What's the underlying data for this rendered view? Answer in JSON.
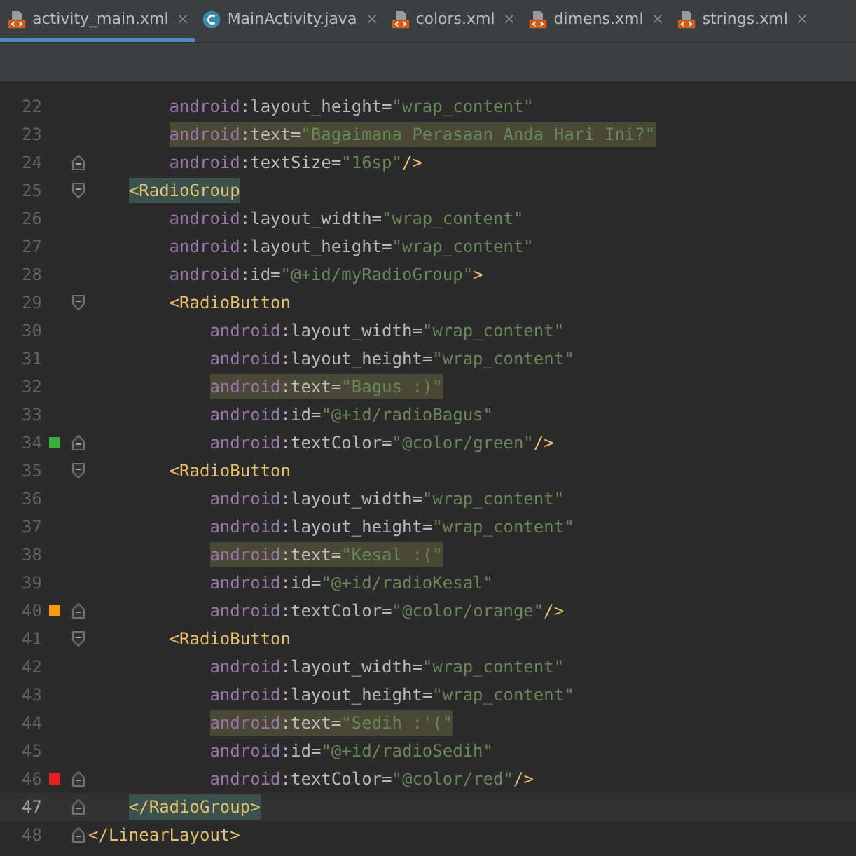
{
  "tabs": [
    {
      "label": "activity_main.xml",
      "kind": "xml",
      "selected": true
    },
    {
      "label": "MainActivity.java",
      "kind": "java",
      "selected": false
    },
    {
      "label": "colors.xml",
      "kind": "xml",
      "selected": false
    },
    {
      "label": "dimens.xml",
      "kind": "xml",
      "selected": false
    },
    {
      "label": "strings.xml",
      "kind": "xml",
      "selected": false
    }
  ],
  "lines": [
    {
      "number": "22",
      "highlighted": false,
      "tag_matched": false,
      "current": false,
      "fold_start": false,
      "fold_end": false,
      "tokens": [
        {
          "kind": "ns",
          "text": "        android"
        },
        {
          "kind": "attr",
          "text": ":layout_height="
        },
        {
          "kind": "value",
          "text": "\"wrap_content\""
        }
      ]
    },
    {
      "number": "23",
      "highlighted": true,
      "tag_matched": false,
      "current": false,
      "fold_start": false,
      "fold_end": false,
      "tokens": [
        {
          "kind": "ns",
          "text": "        android"
        },
        {
          "kind": "attr",
          "text": ":text="
        },
        {
          "kind": "value",
          "text": "\"Bagaimana Perasaan Anda Hari Ini?\""
        }
      ]
    },
    {
      "number": "24",
      "highlighted": false,
      "tag_matched": false,
      "current": false,
      "fold_start": false,
      "fold_end": true,
      "tokens": [
        {
          "kind": "ns",
          "text": "        android"
        },
        {
          "kind": "attr",
          "text": ":textSize="
        },
        {
          "kind": "value",
          "text": "\"16sp\""
        },
        {
          "kind": "tag",
          "text": "/>"
        }
      ]
    },
    {
      "number": "25",
      "highlighted": false,
      "tag_matched": true,
      "current": false,
      "fold_start": true,
      "fold_end": false,
      "tokens": [
        {
          "kind": "tag",
          "text": "    <RadioGroup"
        }
      ]
    },
    {
      "number": "26",
      "highlighted": false,
      "tag_matched": false,
      "current": false,
      "fold_start": false,
      "fold_end": false,
      "tokens": [
        {
          "kind": "ns",
          "text": "        android"
        },
        {
          "kind": "attr",
          "text": ":layout_width="
        },
        {
          "kind": "value",
          "text": "\"wrap_content\""
        }
      ]
    },
    {
      "number": "27",
      "highlighted": false,
      "tag_matched": false,
      "current": false,
      "fold_start": false,
      "fold_end": false,
      "tokens": [
        {
          "kind": "ns",
          "text": "        android"
        },
        {
          "kind": "attr",
          "text": ":layout_height="
        },
        {
          "kind": "value",
          "text": "\"wrap_content\""
        }
      ]
    },
    {
      "number": "28",
      "highlighted": false,
      "tag_matched": false,
      "current": false,
      "fold_start": false,
      "fold_end": false,
      "tokens": [
        {
          "kind": "ns",
          "text": "        android"
        },
        {
          "kind": "attr",
          "text": ":id="
        },
        {
          "kind": "value",
          "text": "\"@+id/myRadioGroup\""
        },
        {
          "kind": "tag",
          "text": ">"
        }
      ]
    },
    {
      "number": "29",
      "highlighted": false,
      "tag_matched": false,
      "current": false,
      "fold_start": true,
      "fold_end": false,
      "tokens": [
        {
          "kind": "tag",
          "text": "        <RadioButton"
        }
      ]
    },
    {
      "number": "30",
      "highlighted": false,
      "tag_matched": false,
      "current": false,
      "fold_start": false,
      "fold_end": false,
      "tokens": [
        {
          "kind": "ns",
          "text": "            android"
        },
        {
          "kind": "attr",
          "text": ":layout_width="
        },
        {
          "kind": "value",
          "text": "\"wrap_content\""
        }
      ]
    },
    {
      "number": "31",
      "highlighted": false,
      "tag_matched": false,
      "current": false,
      "fold_start": false,
      "fold_end": false,
      "tokens": [
        {
          "kind": "ns",
          "text": "            android"
        },
        {
          "kind": "attr",
          "text": ":layout_height="
        },
        {
          "kind": "value",
          "text": "\"wrap_content\""
        }
      ]
    },
    {
      "number": "32",
      "highlighted": true,
      "tag_matched": false,
      "current": false,
      "fold_start": false,
      "fold_end": false,
      "tokens": [
        {
          "kind": "ns",
          "text": "            android"
        },
        {
          "kind": "attr",
          "text": ":text="
        },
        {
          "kind": "value",
          "text": "\"Bagus :)\""
        }
      ]
    },
    {
      "number": "33",
      "highlighted": false,
      "tag_matched": false,
      "current": false,
      "fold_start": false,
      "fold_end": false,
      "tokens": [
        {
          "kind": "ns",
          "text": "            android"
        },
        {
          "kind": "attr",
          "text": ":id="
        },
        {
          "kind": "value",
          "text": "\"@+id/radioBagus\""
        }
      ]
    },
    {
      "number": "34",
      "highlighted": false,
      "tag_matched": false,
      "current": false,
      "fold_start": false,
      "fold_end": true,
      "color": "#3dae3d",
      "tokens": [
        {
          "kind": "ns",
          "text": "            android"
        },
        {
          "kind": "attr",
          "text": ":textColor="
        },
        {
          "kind": "value",
          "text": "\"@color/green\""
        },
        {
          "kind": "tag",
          "text": "/>"
        }
      ]
    },
    {
      "number": "35",
      "highlighted": false,
      "tag_matched": false,
      "current": false,
      "fold_start": true,
      "fold_end": false,
      "tokens": [
        {
          "kind": "tag",
          "text": "        <RadioButton"
        }
      ]
    },
    {
      "number": "36",
      "highlighted": false,
      "tag_matched": false,
      "current": false,
      "fold_start": false,
      "fold_end": false,
      "tokens": [
        {
          "kind": "ns",
          "text": "            android"
        },
        {
          "kind": "attr",
          "text": ":layout_width="
        },
        {
          "kind": "value",
          "text": "\"wrap_content\""
        }
      ]
    },
    {
      "number": "37",
      "highlighted": false,
      "tag_matched": false,
      "current": false,
      "fold_start": false,
      "fold_end": false,
      "tokens": [
        {
          "kind": "ns",
          "text": "            android"
        },
        {
          "kind": "attr",
          "text": ":layout_height="
        },
        {
          "kind": "value",
          "text": "\"wrap_content\""
        }
      ]
    },
    {
      "number": "38",
      "highlighted": true,
      "tag_matched": false,
      "current": false,
      "fold_start": false,
      "fold_end": false,
      "tokens": [
        {
          "kind": "ns",
          "text": "            android"
        },
        {
          "kind": "attr",
          "text": ":text="
        },
        {
          "kind": "value",
          "text": "\"Kesal :(\""
        }
      ]
    },
    {
      "number": "39",
      "highlighted": false,
      "tag_matched": false,
      "current": false,
      "fold_start": false,
      "fold_end": false,
      "tokens": [
        {
          "kind": "ns",
          "text": "            android"
        },
        {
          "kind": "attr",
          "text": ":id="
        },
        {
          "kind": "value",
          "text": "\"@+id/radioKesal\""
        }
      ]
    },
    {
      "number": "40",
      "highlighted": false,
      "tag_matched": false,
      "current": false,
      "fold_start": false,
      "fold_end": true,
      "color": "#f39c12",
      "tokens": [
        {
          "kind": "ns",
          "text": "            android"
        },
        {
          "kind": "attr",
          "text": ":textColor="
        },
        {
          "kind": "value",
          "text": "\"@color/orange\""
        },
        {
          "kind": "tag",
          "text": "/>"
        }
      ]
    },
    {
      "number": "41",
      "highlighted": false,
      "tag_matched": false,
      "current": false,
      "fold_start": true,
      "fold_end": false,
      "tokens": [
        {
          "kind": "tag",
          "text": "        <RadioButton"
        }
      ]
    },
    {
      "number": "42",
      "highlighted": false,
      "tag_matched": false,
      "current": false,
      "fold_start": false,
      "fold_end": false,
      "tokens": [
        {
          "kind": "ns",
          "text": "            android"
        },
        {
          "kind": "attr",
          "text": ":layout_width="
        },
        {
          "kind": "value",
          "text": "\"wrap_content\""
        }
      ]
    },
    {
      "number": "43",
      "highlighted": false,
      "tag_matched": false,
      "current": false,
      "fold_start": false,
      "fold_end": false,
      "tokens": [
        {
          "kind": "ns",
          "text": "            android"
        },
        {
          "kind": "attr",
          "text": ":layout_height="
        },
        {
          "kind": "value",
          "text": "\"wrap_content\""
        }
      ]
    },
    {
      "number": "44",
      "highlighted": true,
      "tag_matched": false,
      "current": false,
      "fold_start": false,
      "fold_end": false,
      "tokens": [
        {
          "kind": "ns",
          "text": "            android"
        },
        {
          "kind": "attr",
          "text": ":text="
        },
        {
          "kind": "value",
          "text": "\"Sedih :'(\""
        }
      ]
    },
    {
      "number": "45",
      "highlighted": false,
      "tag_matched": false,
      "current": false,
      "fold_start": false,
      "fold_end": false,
      "tokens": [
        {
          "kind": "ns",
          "text": "            android"
        },
        {
          "kind": "attr",
          "text": ":id="
        },
        {
          "kind": "value",
          "text": "\"@+id/radioSedih\""
        }
      ]
    },
    {
      "number": "46",
      "highlighted": false,
      "tag_matched": false,
      "current": false,
      "fold_start": false,
      "fold_end": true,
      "color": "#e52222",
      "tokens": [
        {
          "kind": "ns",
          "text": "            android"
        },
        {
          "kind": "attr",
          "text": ":textColor="
        },
        {
          "kind": "value",
          "text": "\"@color/red\""
        },
        {
          "kind": "tag",
          "text": "/>"
        }
      ]
    },
    {
      "number": "47",
      "highlighted": false,
      "tag_matched": true,
      "current": true,
      "fold_start": false,
      "fold_end": true,
      "tokens": [
        {
          "kind": "tag",
          "text": "    </RadioGroup>"
        }
      ]
    },
    {
      "number": "48",
      "highlighted": false,
      "tag_matched": false,
      "current": false,
      "fold_start": false,
      "fold_end": true,
      "tokens": [
        {
          "kind": "tag",
          "text": "</LinearLayout>"
        }
      ]
    }
  ]
}
